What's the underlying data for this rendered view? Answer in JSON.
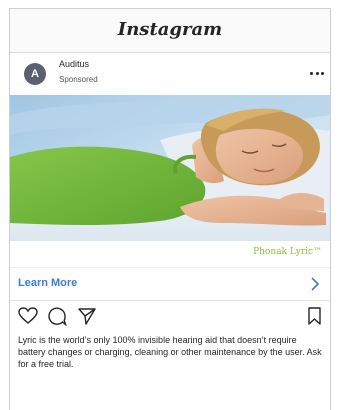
{
  "app": {
    "logo_text": "Instagram"
  },
  "post": {
    "avatar_initial": "A",
    "account_name": "Auditus",
    "sponsored_label": "Sponsored",
    "brand_mark": "Phonak Lyric™",
    "cta_label": "Learn More",
    "caption": "Lyric is the world’s only 100% invisible hearing aid that doesn’t require battery changes or charging, cleaning or other maintenance by the user. Ask for a free trial."
  },
  "icons": {
    "more": "more-options-icon",
    "like": "heart-icon",
    "comment": "comment-icon",
    "share": "paper-plane-icon",
    "save": "bookmark-icon",
    "chevron": "chevron-right-icon"
  },
  "colors": {
    "accent": "#3a7ed6",
    "brand_green": "#8fbf3a"
  }
}
